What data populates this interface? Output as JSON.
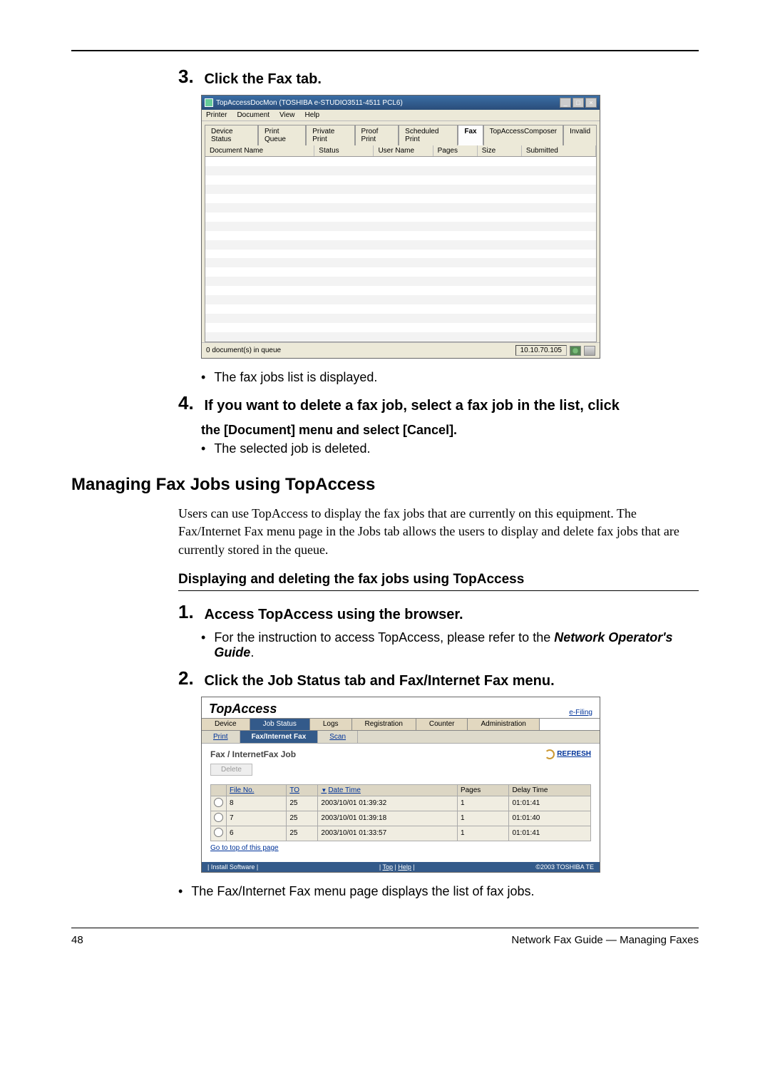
{
  "step3": {
    "num": "3.",
    "title": "Click the Fax tab."
  },
  "bullet_after_shot1": "The fax jobs list is displayed.",
  "step4": {
    "num": "4.",
    "line1": "If you want to delete a fax job, select a fax job in the list, click",
    "line2": "the [Document] menu and select [Cancel].",
    "bullet": "The selected job is deleted."
  },
  "h2": "Managing Fax Jobs using TopAccess",
  "para": "Users can use TopAccess to display the fax jobs that are currently on this equipment. The Fax/Internet Fax menu page in the Jobs tab allows the users to display and delete fax jobs that are currently stored in the queue.",
  "h3": "Displaying and deleting the fax jobs using TopAccess",
  "step1": {
    "num": "1.",
    "title": "Access TopAccess using the browser.",
    "bullet_a": "For the instruction to access TopAccess, please refer to the ",
    "bullet_b": "Network Operator's Guide",
    "bullet_c": "."
  },
  "step2": {
    "num": "2.",
    "title": "Click the Job Status tab and Fax/Internet Fax menu."
  },
  "bullet_after_shot2": "The Fax/Internet Fax menu page displays the list of fax jobs.",
  "footer": {
    "page": "48",
    "right": "Network Fax Guide — Managing Faxes"
  },
  "win1": {
    "title": "TopAccessDocMon (TOSHIBA e-STUDIO3511-4511 PCL6)",
    "menus": [
      "Printer",
      "Document",
      "View",
      "Help"
    ],
    "tabs": [
      "Device Status",
      "Print Queue",
      "Private Print",
      "Proof Print",
      "Scheduled Print",
      "Fax",
      "TopAccessComposer",
      "Invalid"
    ],
    "active_tab": "Fax",
    "cols": [
      "Document Name",
      "Status",
      "User Name",
      "Pages",
      "Size",
      "Submitted"
    ],
    "status_left": "0 document(s) in queue",
    "status_ip": "10.10.70.105",
    "winbtn_min": "_",
    "winbtn_max": "□",
    "winbtn_close": "×"
  },
  "win2": {
    "logo": "TopAccess",
    "efiling": "e-Filing",
    "tabs": [
      "Device",
      "Job Status",
      "Logs",
      "Registration",
      "Counter",
      "Administration"
    ],
    "active_tab": "Job Status",
    "subtabs": [
      "Print",
      "Fax/Internet Fax",
      "Scan"
    ],
    "active_sub": "Fax/Internet Fax",
    "heading": "Fax / InternetFax Job",
    "refresh": "REFRESH",
    "delete": "Delete",
    "cols": {
      "fileno": "File No.",
      "to": "TO",
      "datetime": "Date Time",
      "pages": "Pages",
      "delay": "Delay Time"
    },
    "rows": [
      {
        "fileno": "8",
        "to": "25",
        "date": "2003/10/01 01:39:32",
        "pages": "1",
        "delay": "01:01:41"
      },
      {
        "fileno": "7",
        "to": "25",
        "date": "2003/10/01 01:39:18",
        "pages": "1",
        "delay": "01:01:40"
      },
      {
        "fileno": "6",
        "to": "25",
        "date": "2003/10/01 01:33:57",
        "pages": "1",
        "delay": "01:01:41"
      }
    ],
    "gotop": "Go to top of this page",
    "foot_left": "|  Install Software  |",
    "foot_mid_top": "Top",
    "foot_mid_help": "Help",
    "foot_right": "©2003 TOSHIBA TE"
  }
}
